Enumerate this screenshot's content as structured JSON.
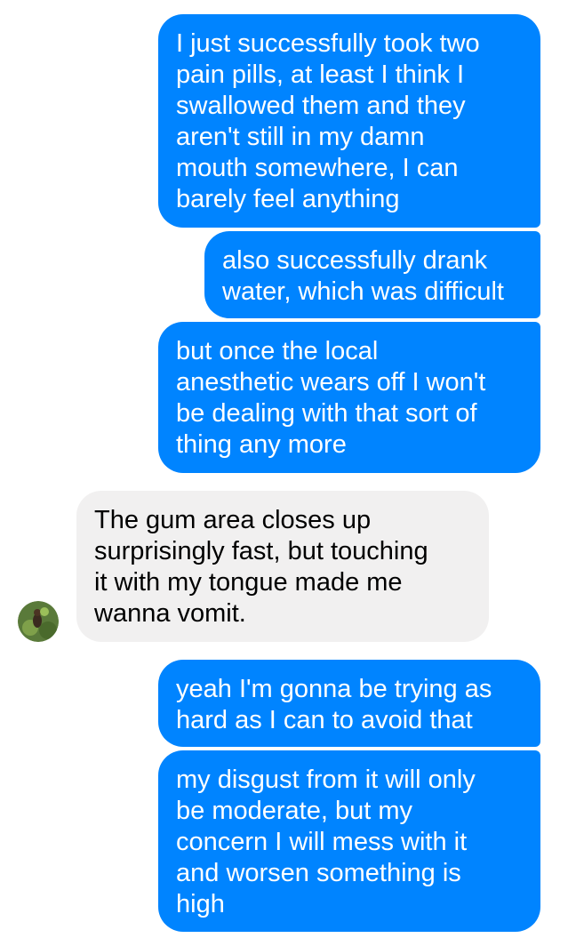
{
  "messages": [
    {
      "direction": "outgoing",
      "text": "I just successfully took two\npain pills, at least I think I\nswallowed them and they\naren't still in my damn\nmouth somewhere, I can\nbarely feel anything"
    },
    {
      "direction": "outgoing",
      "text": "also successfully drank\nwater, which was difficult"
    },
    {
      "direction": "outgoing",
      "text": "but once the local\nanesthetic wears off I won't\nbe dealing with that sort of\nthing any more"
    },
    {
      "direction": "incoming",
      "text": "The gum area closes up\nsurprisingly fast, but touching\nit with my tongue made me\nwanna vomit."
    },
    {
      "direction": "outgoing",
      "text": "yeah I'm gonna be trying as\nhard as I can to avoid that"
    },
    {
      "direction": "outgoing",
      "text": "my disgust from it will only\nbe moderate, but my\nconcern I will mess with it\nand worsen something is\nhigh"
    }
  ],
  "contact": {
    "avatar_icon": "contact-avatar-icon"
  },
  "colors": {
    "outgoing_bubble": "#0084ff",
    "outgoing_text": "#ffffff",
    "incoming_bubble": "#f1f0f0",
    "incoming_text": "#000000"
  }
}
